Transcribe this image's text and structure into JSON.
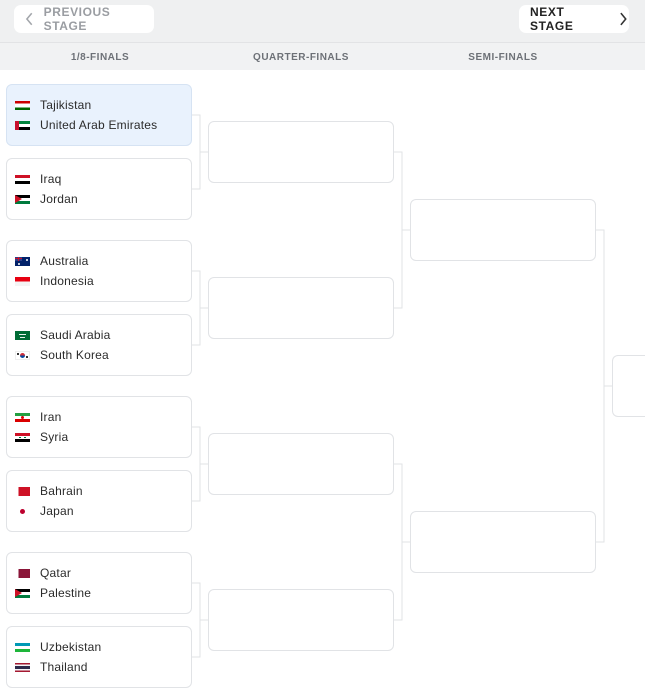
{
  "nav": {
    "prev_label": "PREVIOUS STAGE",
    "next_label": "NEXT STAGE"
  },
  "stages": [
    "1/8-FINALS",
    "QUARTER-FINALS",
    "SEMI-FINALS"
  ],
  "round_of_16": [
    {
      "highlighted": true,
      "teams": [
        {
          "name": "Tajikistan",
          "flag": "tajikistan-flag-icon"
        },
        {
          "name": "United Arab Emirates",
          "flag": "uae-flag-icon"
        }
      ]
    },
    {
      "highlighted": false,
      "teams": [
        {
          "name": "Iraq",
          "flag": "iraq-flag-icon"
        },
        {
          "name": "Jordan",
          "flag": "jordan-flag-icon"
        }
      ]
    },
    {
      "highlighted": false,
      "teams": [
        {
          "name": "Australia",
          "flag": "australia-flag-icon"
        },
        {
          "name": "Indonesia",
          "flag": "indonesia-flag-icon"
        }
      ]
    },
    {
      "highlighted": false,
      "teams": [
        {
          "name": "Saudi Arabia",
          "flag": "saudi-arabia-flag-icon"
        },
        {
          "name": "South Korea",
          "flag": "south-korea-flag-icon"
        }
      ]
    },
    {
      "highlighted": false,
      "teams": [
        {
          "name": "Iran",
          "flag": "iran-flag-icon"
        },
        {
          "name": "Syria",
          "flag": "syria-flag-icon"
        }
      ]
    },
    {
      "highlighted": false,
      "teams": [
        {
          "name": "Bahrain",
          "flag": "bahrain-flag-icon"
        },
        {
          "name": "Japan",
          "flag": "japan-flag-icon"
        }
      ]
    },
    {
      "highlighted": false,
      "teams": [
        {
          "name": "Qatar",
          "flag": "qatar-flag-icon"
        },
        {
          "name": "Palestine",
          "flag": "palestine-flag-icon"
        }
      ]
    },
    {
      "highlighted": false,
      "teams": [
        {
          "name": "Uzbekistan",
          "flag": "uzbekistan-flag-icon"
        },
        {
          "name": "Thailand",
          "flag": "thailand-flag-icon"
        }
      ]
    }
  ],
  "colors": {
    "highlight_bg": "#e9f2fd",
    "border": "#e1e3e6",
    "header_bg": "#eff0f1"
  }
}
